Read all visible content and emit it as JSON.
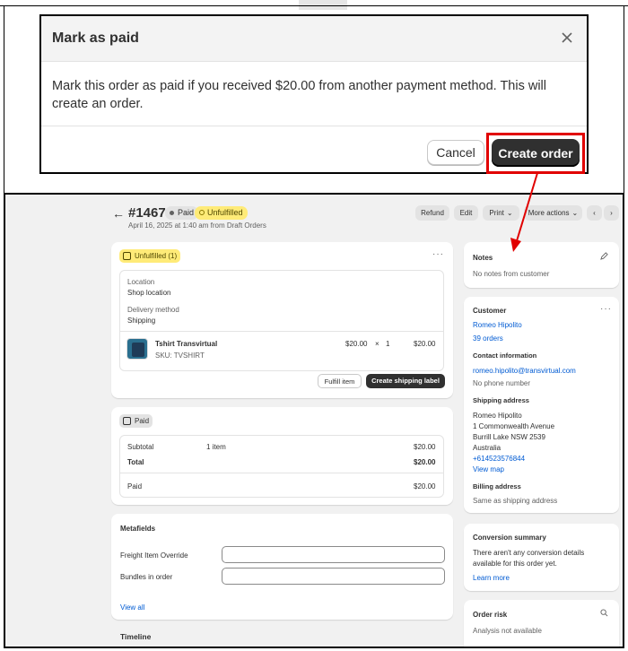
{
  "modal": {
    "title": "Mark as paid",
    "body": "Mark this order as paid if you received $20.00 from another payment method. This will create an order.",
    "cancel_label": "Cancel",
    "create_label": "Create order"
  },
  "order": {
    "number": "#1467",
    "paid_badge": "Paid",
    "unfulfilled_badge": "Unfulfilled",
    "subtitle": "April 16, 2025 at 1:40 am from Draft Orders"
  },
  "actions": {
    "refund": "Refund",
    "edit": "Edit",
    "print": "Print",
    "more": "More actions"
  },
  "fulfillment": {
    "badge": "Unfulfilled (1)",
    "location_label": "Location",
    "location_value": "Shop location",
    "delivery_label": "Delivery method",
    "delivery_value": "Shipping",
    "item_name": "Tshirt Transvirtual",
    "sku": "SKU: TVSHIRT",
    "price": "$20.00",
    "times": "×",
    "qty": "1",
    "total": "$20.00",
    "fulfill_btn": "Fulfill item",
    "shipping_btn": "Create shipping label"
  },
  "payment": {
    "badge": "Paid",
    "subtotal_label": "Subtotal",
    "subtotal_items": "1 item",
    "subtotal_value": "$20.00",
    "total_label": "Total",
    "total_value": "$20.00",
    "paid_label": "Paid",
    "paid_value": "$20.00"
  },
  "metafields": {
    "title": "Metafields",
    "field1_label": "Freight Item Override",
    "field2_label": "Bundles in order",
    "view_all": "View all"
  },
  "timeline": {
    "title": "Timeline"
  },
  "notes": {
    "title": "Notes",
    "empty": "No notes from customer"
  },
  "customer": {
    "title": "Customer",
    "name": "Romeo Hipolito",
    "orders": "39 orders",
    "contact_title": "Contact information",
    "email": "romeo.hipolito@transvirtual.com",
    "phone": "No phone number",
    "shipping_title": "Shipping address",
    "ship_line1": "Romeo Hipolito",
    "ship_line2": "1 Commonwealth Avenue",
    "ship_line3": "Burrill Lake NSW 2539",
    "ship_line4": "Australia",
    "ship_phone": "+614523576844",
    "view_map": "View map",
    "billing_title": "Billing address",
    "billing_value": "Same as shipping address"
  },
  "conversion": {
    "title": "Conversion summary",
    "text1": "There aren't any conversion details",
    "text2": "available for this order yet.",
    "learn_more": "Learn more"
  },
  "risk": {
    "title": "Order risk",
    "text": "Analysis not available"
  },
  "colors": {
    "highlight": "#e10000",
    "primary_button": "#303030",
    "link": "#005bd3",
    "unfulfilled_bg": "#ffeb78"
  }
}
